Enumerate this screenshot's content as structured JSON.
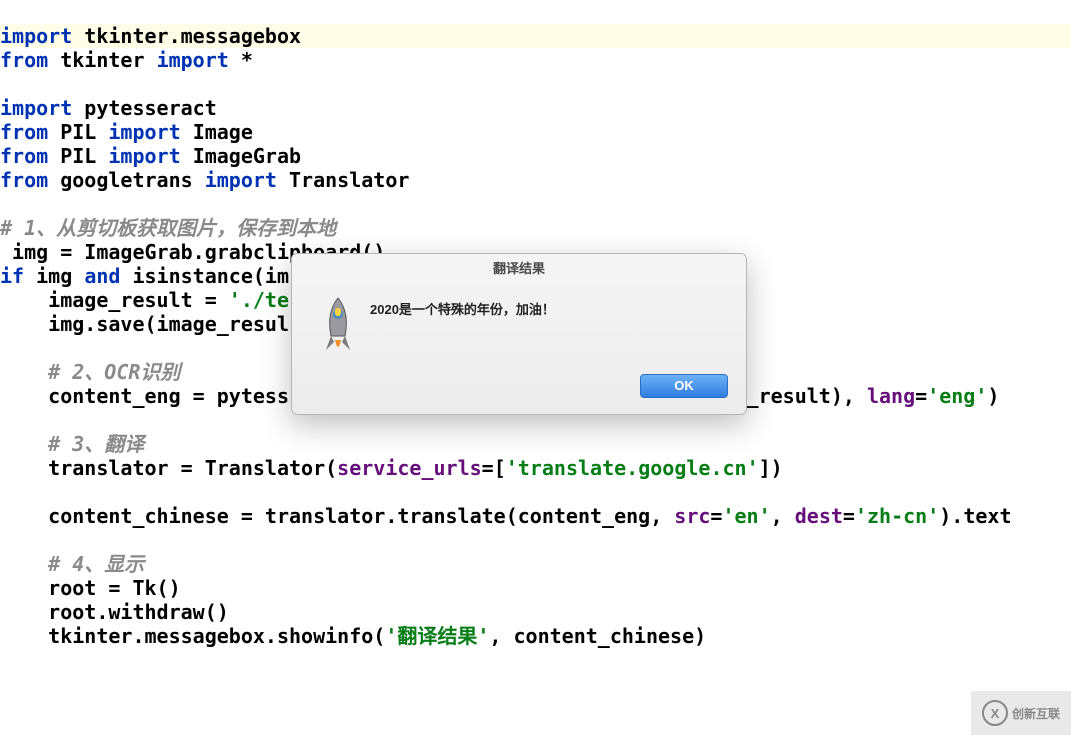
{
  "code": {
    "l1_import": "import",
    "l1_module": "tkinter.messagebox",
    "l2_from": "from",
    "l2_pkg": "tkinter",
    "l2_import": "import",
    "l2_star": "*",
    "l4_import": "import",
    "l4_module": "pytesseract",
    "l5_from": "from",
    "l5_pkg": "PIL",
    "l5_import": "import",
    "l5_name": "Image",
    "l6_from": "from",
    "l6_pkg": "PIL",
    "l6_import": "import",
    "l6_name": "ImageGrab",
    "l7_from": "from",
    "l7_pkg": "googletrans",
    "l7_import": "import",
    "l7_name": "Translator",
    "c1": "# 1、从剪切板获取图片，保存到本地",
    "l9": " img = ImageGrab.grabclipboard()",
    "l10_if": "if",
    "l10_a": " img ",
    "l10_and": "and",
    "l10_b": " isinstance(im",
    "l11_a": "    image_result = ",
    "l11_b": "'./te",
    "l12": "    img.save(image_resul",
    "c2": "    # 2、OCR识别",
    "l14_a": "    content_eng = pytess",
    "l14_b": "_result), ",
    "l14_arg": "lang",
    "l14_c": "=",
    "l14_str": "'eng'",
    "l14_d": ")",
    "c3": "    # 3、翻译",
    "l16_a": "    translator = Translator(",
    "l16_arg": "service_urls",
    "l16_b": "=[",
    "l16_str": "'translate.google.cn'",
    "l16_c": "])",
    "l18_a": "    content_chinese = translator.translate(content_eng, ",
    "l18_arg1": "src",
    "l18_b": "=",
    "l18_str1": "'en'",
    "l18_c": ", ",
    "l18_arg2": "dest",
    "l18_d": "=",
    "l18_str2": "'zh-cn'",
    "l18_e": ").text",
    "c4": "    # 4、显示",
    "l20": "    root = Tk()",
    "l21": "    root.withdraw()",
    "l22_a": "    tkinter.messagebox.showinfo(",
    "l22_str": "'翻译结果'",
    "l22_b": ", content_chinese)"
  },
  "dialog": {
    "title": "翻译结果",
    "message": "2020是一个特殊的年份，加油！",
    "ok": "OK"
  },
  "watermark": {
    "text": "创新互联",
    "icon": "X"
  }
}
